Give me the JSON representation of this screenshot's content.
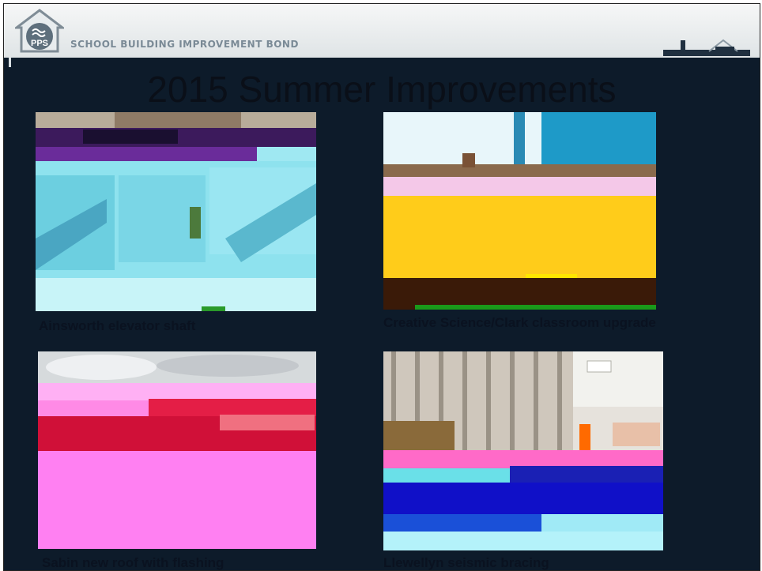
{
  "header": {
    "logo_text": "PPS",
    "bond_label": "SCHOOL BUILDING IMPROVEMENT BOND"
  },
  "slide": {
    "title": "2015 Summer Improvements"
  },
  "photos": [
    {
      "caption": "Ainsworth elevator shaft"
    },
    {
      "caption": "Creative Science/Clark classroom upgrade"
    },
    {
      "caption": "Sabin new roof with flashing"
    },
    {
      "caption": "Llewellyn seismic bracing"
    }
  ]
}
